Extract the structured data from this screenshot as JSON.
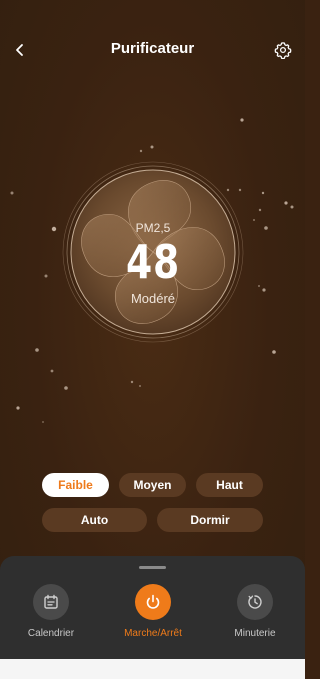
{
  "header": {
    "title": "Purificateur",
    "back_icon": "chevron-left-icon",
    "settings_icon": "gear-icon"
  },
  "air_quality": {
    "label": "PM2,5",
    "value": "48",
    "status": "Modéré"
  },
  "speed_modes": [
    {
      "label": "Faible",
      "active": true
    },
    {
      "label": "Moyen",
      "active": false
    },
    {
      "label": "Haut",
      "active": false
    }
  ],
  "extra_modes": [
    {
      "label": "Auto",
      "active": false
    },
    {
      "label": "Dormir",
      "active": false
    }
  ],
  "controls": [
    {
      "label": "Calendrier",
      "icon": "calendar-icon"
    },
    {
      "label": "Marche/Arrêt",
      "icon": "power-icon",
      "active": true
    },
    {
      "label": "Minuterie",
      "icon": "timer-icon"
    }
  ],
  "colors": {
    "background": "#3a2211",
    "accent": "#ef7b1a",
    "panel": "#2f2f2f"
  }
}
